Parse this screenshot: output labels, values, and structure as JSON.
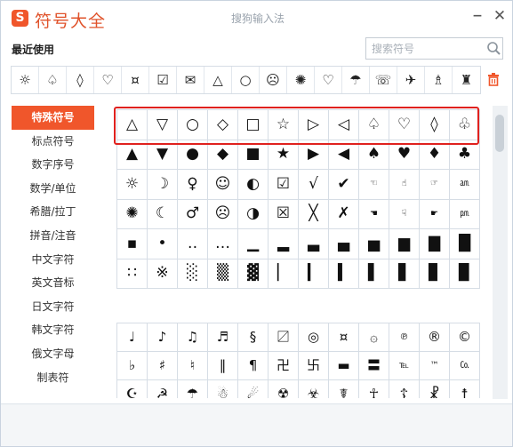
{
  "app": {
    "logo_letter": "S",
    "title": "符号大全",
    "ime_name": "搜狗输入法",
    "minimize": "−",
    "close": "✕"
  },
  "recent": {
    "label": "最近使用",
    "symbols": [
      "☼",
      "♤",
      "◊",
      "♡",
      "¤",
      "☑",
      "✉",
      "△",
      "○",
      "☹",
      "✺",
      "♡",
      "☂",
      "☏",
      "✈",
      "♗",
      "♜"
    ]
  },
  "search": {
    "placeholder": "搜索符号",
    "icon": "search-icon"
  },
  "sidebar": {
    "items": [
      {
        "label": "特殊符号",
        "active": true
      },
      {
        "label": "标点符号"
      },
      {
        "label": "数字序号"
      },
      {
        "label": "数学/单位"
      },
      {
        "label": "希腊/拉丁"
      },
      {
        "label": "拼音/注音"
      },
      {
        "label": "中文字符"
      },
      {
        "label": "英文音标"
      },
      {
        "label": "日文字符"
      },
      {
        "label": "韩文字符"
      },
      {
        "label": "俄文字母"
      },
      {
        "label": "制表符"
      }
    ]
  },
  "grid1": {
    "rows": [
      [
        "△",
        "▽",
        "○",
        "◇",
        "□",
        "☆",
        "▷",
        "◁",
        "♤",
        "♡",
        "◊",
        "♧"
      ],
      [
        "▲",
        "▼",
        "●",
        "◆",
        "■",
        "★",
        "▶",
        "◀",
        "♠",
        "♥",
        "♦",
        "♣"
      ],
      [
        "☼",
        "☽",
        "♀",
        "☺",
        "◐",
        "☑",
        "√",
        "✔",
        "☜",
        "☝",
        "☞",
        "㏂"
      ],
      [
        "✺",
        "☾",
        "♂",
        "☹",
        "◑",
        "☒",
        "╳",
        "✗",
        "☚",
        "☟",
        "☛",
        "㏘"
      ],
      [
        "▪",
        "•",
        "‥",
        "…",
        "▁",
        "▂",
        "▃",
        "▄",
        "▅",
        "▆",
        "▇",
        "█"
      ],
      [
        "∷",
        "※",
        "░",
        "▒",
        "▓",
        "▏",
        "▎",
        "▍",
        "▌",
        "▋",
        "▊",
        "▉"
      ]
    ]
  },
  "grid2": {
    "rows": [
      [
        "♩",
        "♪",
        "♫",
        "♬",
        "§",
        "〼",
        "◎",
        "¤",
        "۞",
        "℗",
        "®",
        "©"
      ],
      [
        "♭",
        "♯",
        "♮",
        "‖",
        "¶",
        "卍",
        "卐",
        "▬",
        "〓",
        "℡",
        "™",
        "㏇"
      ],
      [
        "☪",
        "☭",
        "☂",
        "☃",
        "☄",
        "☢",
        "☣",
        "☤",
        "☥",
        "☦",
        "☧",
        "☨"
      ]
    ]
  },
  "colors": {
    "accent": "#f0562b",
    "highlight": "#e0211e"
  }
}
